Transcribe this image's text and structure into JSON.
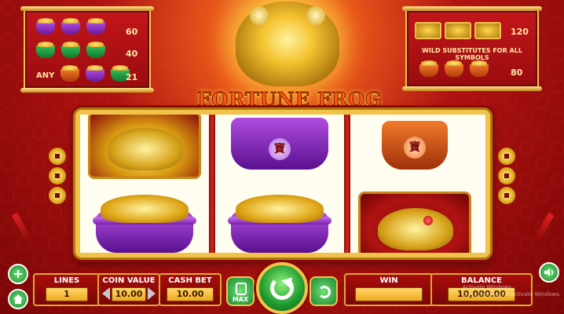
{
  "game": {
    "title": "FORTUNE FROG"
  },
  "paytable_left": {
    "rows": [
      {
        "symbols": [
          "purple-pot",
          "purple-pot",
          "purple-pot"
        ],
        "payout": "60"
      },
      {
        "symbols": [
          "green-pot",
          "green-pot",
          "green-pot"
        ],
        "payout": "40"
      },
      {
        "label": "ANY",
        "symbols": [
          "orange-pot",
          "purple-pot",
          "green-pot"
        ],
        "payout": "21"
      }
    ]
  },
  "paytable_right": {
    "rows": [
      {
        "symbols": [
          "frog-card",
          "frog-card",
          "frog-card"
        ],
        "payout": "120"
      },
      {
        "symbols": [
          "orange-pot",
          "orange-pot",
          "orange-pot"
        ],
        "payout": "80"
      }
    ],
    "wild_text": "WILD SUBSTITUTES FOR ALL SYMBOLS"
  },
  "reels": [
    {
      "symbols": [
        "frog-card",
        "purple-pot-coins"
      ]
    },
    {
      "symbols": [
        "purple-pot",
        "purple-pot-coins"
      ]
    },
    {
      "symbols": [
        "orange-pot",
        "frog-card"
      ]
    }
  ],
  "pot_glyph": "寶",
  "controls": {
    "lines_label": "LINES",
    "lines_value": "1",
    "coin_value_label": "COIN VALUE",
    "coin_value": "10.00",
    "cash_bet_label": "CASH BET",
    "cash_bet_value": "10.00",
    "win_label": "WIN",
    "win_value": "",
    "balance_label": "BALANCE",
    "balance_value": "10,000.00",
    "max_label": "MAX"
  },
  "side_buttons": {
    "plus_glyph": "+",
    "home_icon": "home-icon",
    "sound_icon": "speaker-icon"
  },
  "watermark": {
    "line1": "Activate Windows",
    "line2": "Go to Settings to activate Windows."
  }
}
